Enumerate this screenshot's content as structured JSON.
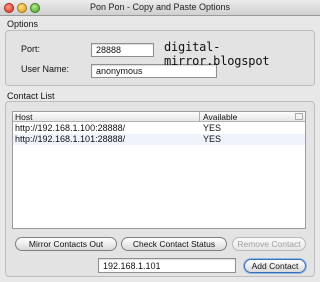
{
  "window": {
    "title": "Pon Pon - Copy and Paste Options"
  },
  "options": {
    "section_label": "Options",
    "port_label": "Port:",
    "port_value": "28888",
    "username_label": "User Name:",
    "username_value": "anonymous",
    "watermark": "digital-mirror.blogspot"
  },
  "contacts": {
    "section_label": "Contact List",
    "columns": [
      "Host",
      "Available"
    ],
    "rows": [
      {
        "host": "http://192.168.1.100:28888/",
        "available": "YES"
      },
      {
        "host": "http://192.168.1.101:28888/",
        "available": "YES"
      }
    ],
    "buttons": {
      "mirror": "Mirror Contacts Out",
      "check": "Check Contact Status",
      "remove": "Remove Contact",
      "add": "Add Contact"
    },
    "new_contact_value": "192.168.1.101"
  }
}
